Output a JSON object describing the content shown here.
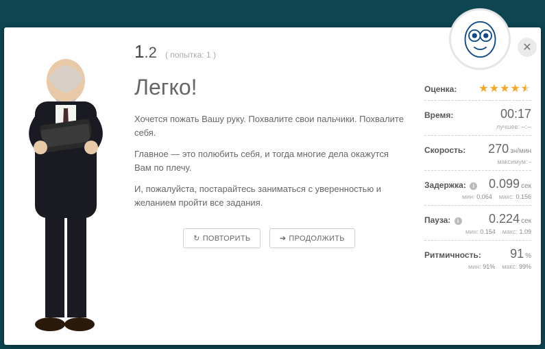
{
  "lesson": {
    "number_major": "1",
    "number_minor": ".2",
    "attempt_label": "( попытка: 1 )"
  },
  "title": "Легко!",
  "paragraphs": [
    "Хочется пожать Вашу руку. Похвалите свои пальчики. Похвалите себя.",
    "Главное — это полюбить себя, и тогда многие дела окажутся Вам по плечу.",
    "И, пожалуйста, постарайтесь заниматься с уверенностью и желанием пройти все задания."
  ],
  "buttons": {
    "repeat": "ПОВТОРИТЬ",
    "continue": "ПРОДОЛЖИТЬ"
  },
  "stats": {
    "rating": {
      "label": "Оценка:",
      "stars": 4.5
    },
    "time": {
      "label": "Время:",
      "value": "00:17",
      "sub_label": "лучшее:",
      "sub_value": "--:--"
    },
    "speed": {
      "label": "Скорость:",
      "value": "270",
      "unit": "зн/мин",
      "sub_label": "максимум:",
      "sub_value": "-"
    },
    "delay": {
      "label": "Задержка:",
      "value": "0.099",
      "unit": "сек",
      "min_lbl": "мин:",
      "min": "0.064",
      "max_lbl": "макс:",
      "max": "0.156"
    },
    "pause": {
      "label": "Пауза:",
      "value": "0.224",
      "unit": "сек",
      "min_lbl": "мин:",
      "min": "0.154",
      "max_lbl": "макс:",
      "max": "1.09"
    },
    "rhythm": {
      "label": "Ритмичность:",
      "value": "91",
      "unit": "%",
      "min_lbl": "мин:",
      "min": "91%",
      "max_lbl": "макс:",
      "max": "99%"
    }
  }
}
